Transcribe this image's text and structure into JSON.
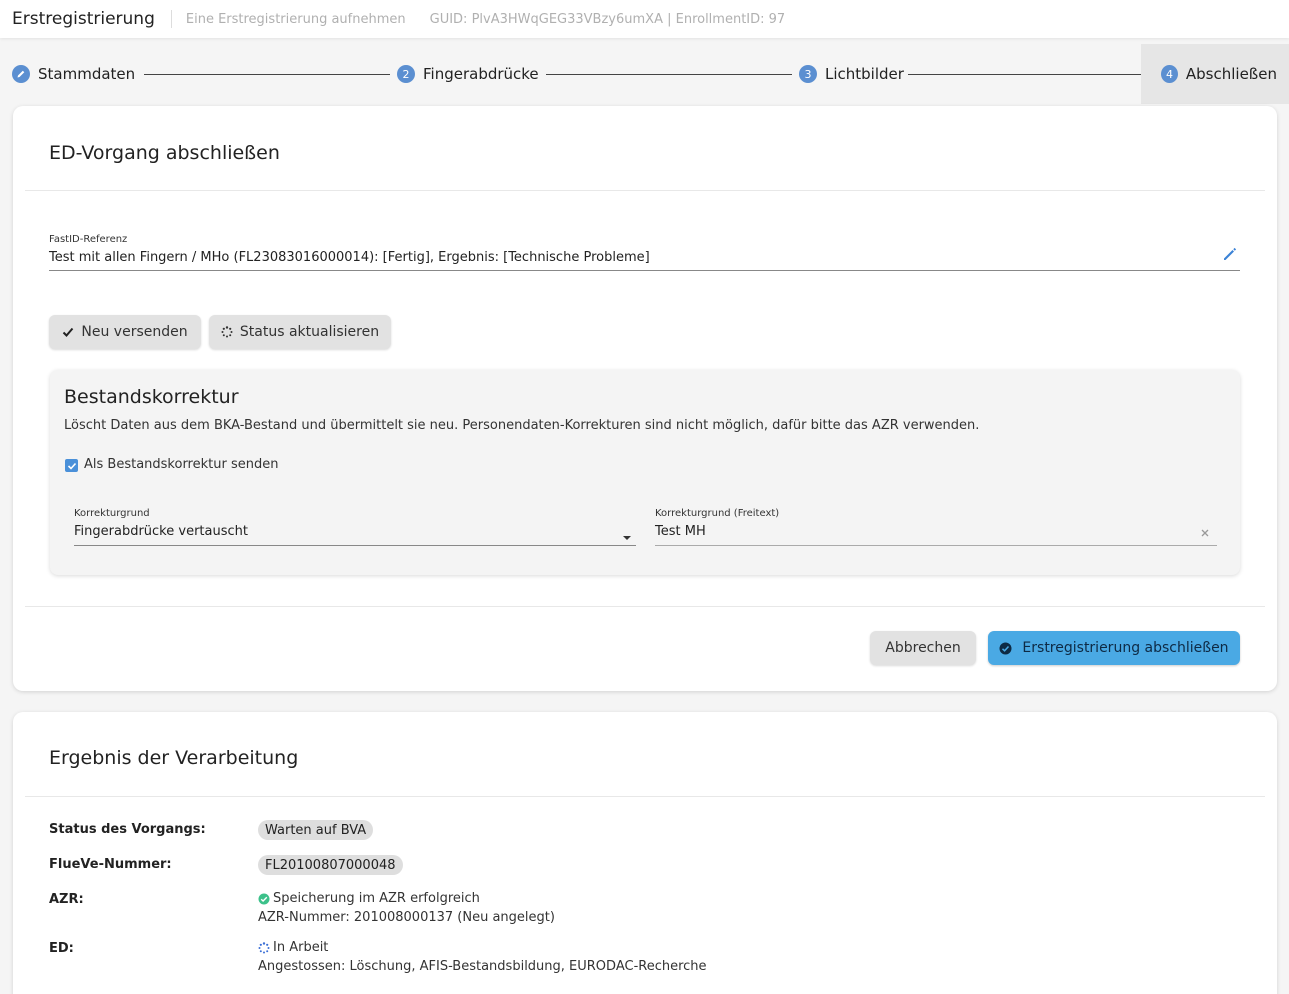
{
  "header": {
    "title": "Erstregistrierung",
    "subtitle": "Eine Erstregistrierung aufnehmen",
    "guid_info": "GUID: PlvA3HWqGEG33VBzy6umXA | EnrollmentID: 97"
  },
  "stepper": {
    "steps": [
      {
        "number": "",
        "label": "Stammdaten",
        "state": "completed"
      },
      {
        "number": "2",
        "label": "Fingerabdrücke",
        "state": "pending"
      },
      {
        "number": "3",
        "label": "Lichtbilder",
        "state": "pending"
      },
      {
        "number": "4",
        "label": "Abschließen",
        "state": "active"
      }
    ]
  },
  "complete_card": {
    "title": "ED-Vorgang abschließen",
    "fastid": {
      "label": "FastID-Referenz",
      "value": "Test mit allen Fingern / MHo (FL23083016000014): [Fertig], Ergebnis: [Technische Probleme]"
    },
    "buttons": {
      "resend": "Neu versenden",
      "refresh_status": "Status aktualisieren"
    },
    "correction": {
      "title": "Bestandskorrektur",
      "description": "Löscht Daten aus dem BKA-Bestand und übermittelt sie neu. Personendaten-Korrekturen sind nicht möglich, dafür bitte das AZR verwenden.",
      "checkbox_label": "Als Bestandskorrektur senden",
      "checkbox_checked": true,
      "reason_label": "Korrekturgrund",
      "reason_value": "Fingerabdrücke vertauscht",
      "freetext_label": "Korrekturgrund (Freitext)",
      "freetext_value": "Test MH"
    },
    "actions": {
      "cancel": "Abbrechen",
      "finish": "Erstregistrierung abschließen"
    }
  },
  "result_card": {
    "title": "Ergebnis der Verarbeitung",
    "status_label": "Status des Vorgangs:",
    "status_value": "Warten auf BVA",
    "flueve_label": "FlueVe-Nummer:",
    "flueve_value": "FL20100807000048",
    "azr_label": "AZR:",
    "azr_status": "Speicherung im AZR erfolgreich",
    "azr_number": "AZR-Nummer: 201008000137 (Neu angelegt)",
    "ed_label": "ED:",
    "ed_status": "In Arbeit",
    "ed_detail": "Angestossen: Löschung, AFIS-Bestandsbildung, EURODAC-Recherche"
  },
  "colors": {
    "accent": "#4aa9e4",
    "step": "#5b8fd1",
    "success": "#3cc18a"
  }
}
